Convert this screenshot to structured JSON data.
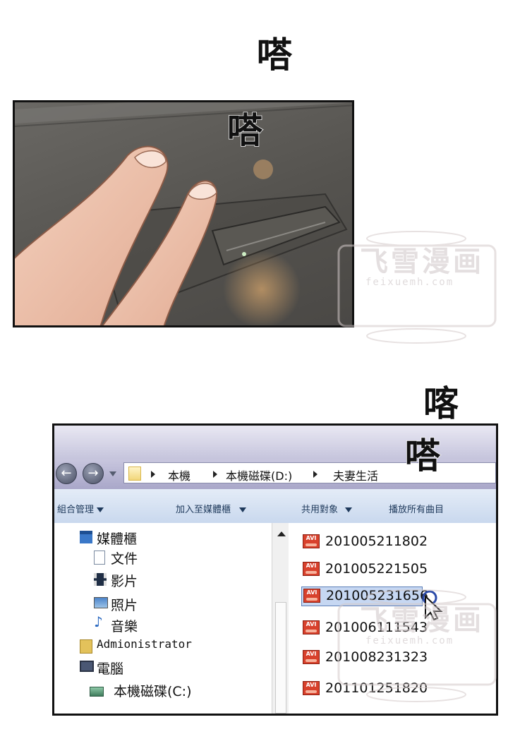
{
  "sfx": {
    "top_a": "嗒",
    "top_b": "嗒",
    "mid_a": "喀",
    "mid_b": "嗒"
  },
  "watermark": {
    "title": "飞雪漫画",
    "url": "feixuemh.com"
  },
  "explorer": {
    "breadcrumbs": [
      "本機",
      "本機磁碟(D:)",
      "夫妻生活"
    ],
    "toolbar": {
      "organize": "組合管理",
      "add_to_library": "加入至媒體櫃",
      "share_with": "共用對象",
      "play_all": "播放所有曲目"
    },
    "nav": {
      "library": "媒體櫃",
      "documents": "文件",
      "videos": "影片",
      "pictures": "照片",
      "music": "音樂",
      "user": "Admionistrator",
      "computer": "電腦",
      "local_disk_c": "本機磁碟(C:)"
    },
    "files": [
      {
        "icon_label": "AVI",
        "name": "201005211802"
      },
      {
        "icon_label": "AVI",
        "name": "201005221505"
      },
      {
        "icon_label": "AVI",
        "name": "201005231656"
      },
      {
        "icon_label": "AVI",
        "name": "201006111543"
      },
      {
        "icon_label": "AVI",
        "name": "201008231323"
      },
      {
        "icon_label": "AVI",
        "name": "201101251820"
      }
    ],
    "selected_index": 2
  },
  "colors": {
    "border": "#111111",
    "toolbar_text": "#1e395b",
    "selection": "#c6d7f2",
    "avi_icon": "#d8412c"
  }
}
